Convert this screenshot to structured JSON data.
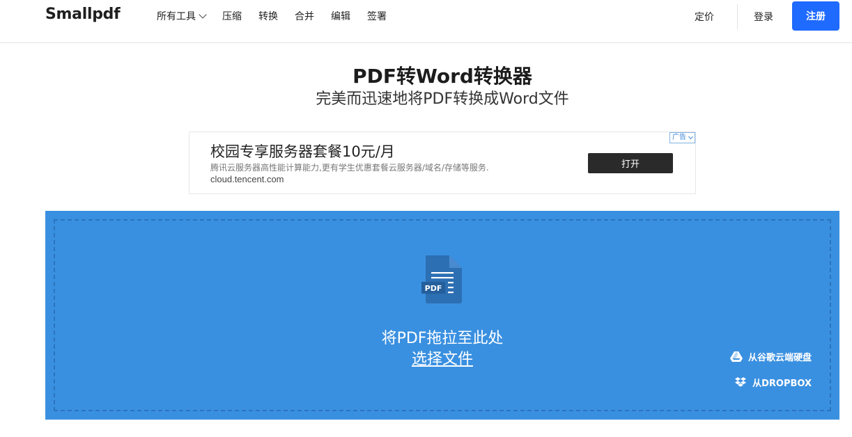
{
  "header": {
    "logo": "Smallpdf",
    "nav": [
      {
        "label": "所有工具",
        "has_dropdown": true
      },
      {
        "label": "压缩"
      },
      {
        "label": "转换"
      },
      {
        "label": "合并"
      },
      {
        "label": "编辑"
      },
      {
        "label": "签署"
      }
    ],
    "pricing": "定价",
    "login": "登录",
    "signup": "注册"
  },
  "hero": {
    "title": "PDF转Word转换器",
    "subtitle": "完美而迅速地将PDF转换成Word文件"
  },
  "ad": {
    "badge": "广告",
    "title": "校园专享服务器套餐10元/月",
    "description": "腾讯云服务器高性能计算能力,更有学生优惠套餐云服务器/域名/存储等服务.",
    "url": "cloud.tencent.com",
    "button": "打开"
  },
  "upload": {
    "icon_label": "PDF",
    "drop_text": "将PDF拖拉至此处",
    "choose_file": "选择文件",
    "gdrive": "从谷歌云端硬盘",
    "dropbox": "从DROPBOX"
  },
  "colors": {
    "accent": "#1f6aff",
    "upload_bg": "#3a90e0",
    "upload_border": "#2a73bd"
  }
}
